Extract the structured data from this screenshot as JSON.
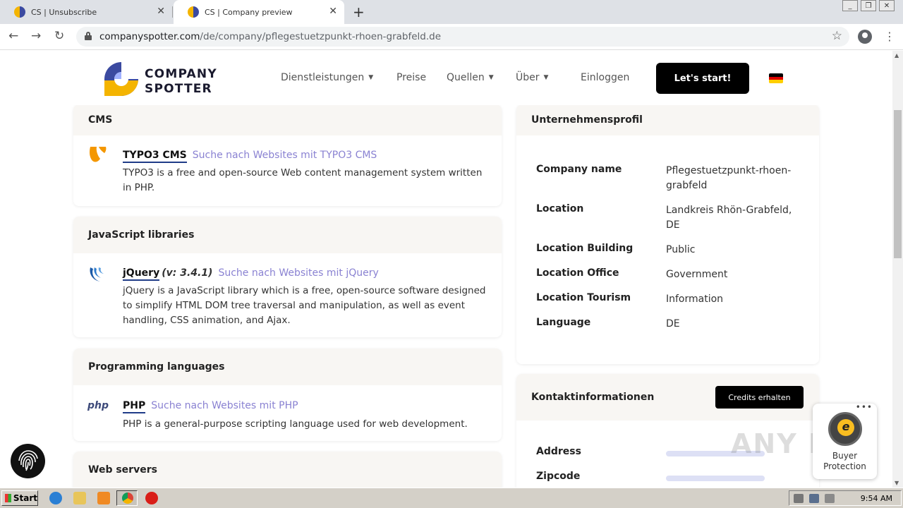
{
  "browser": {
    "tabs": [
      {
        "title": "CS | Unsubscribe",
        "active": false
      },
      {
        "title": "CS | Company preview",
        "active": true
      }
    ],
    "url_host": "companyspotter.com",
    "url_path": "/de/company/pflegestuetzpunkt-rhoen-grabfeld.de"
  },
  "header": {
    "logo_line1": "COMPANY",
    "logo_line2": "SPOTTER",
    "nav": [
      "Dienstleistungen",
      "Preise",
      "Quellen",
      "Über",
      "Einloggen"
    ],
    "cta": "Let's start!"
  },
  "sections": {
    "cms": {
      "title": "CMS",
      "name": "TYPO3 CMS",
      "link": "Suche nach Websites mit TYPO3 CMS",
      "desc": "TYPO3 is a free and open-source Web content management system written in PHP."
    },
    "js": {
      "title": "JavaScript libraries",
      "name": "jQuery",
      "version": "(v: 3.4.1)",
      "link": "Suche nach Websites mit jQuery",
      "desc": "jQuery is a JavaScript library which is a free, open-source software designed to simplify HTML DOM tree traversal and manipulation, as well as event handling, CSS animation, and Ajax."
    },
    "prog": {
      "title": "Programming languages",
      "icon_text": "php",
      "name": "PHP",
      "link": "Suche nach Websites mit PHP",
      "desc": "PHP is a general-purpose scripting language used for web development."
    },
    "web": {
      "title": "Web servers"
    }
  },
  "profile": {
    "title": "Unternehmensprofil",
    "rows": [
      {
        "label": "Company name",
        "value": "Pflegestuetzpunkt-rhoen-grabfeld"
      },
      {
        "label": "Location",
        "value": "Landkreis Rhön-Grabfeld, DE"
      },
      {
        "label": "Location Building",
        "value": "Public"
      },
      {
        "label": "Location Office",
        "value": "Government"
      },
      {
        "label": "Location Tourism",
        "value": "Information"
      },
      {
        "label": "Language",
        "value": "DE"
      }
    ]
  },
  "contact": {
    "title": "Kontaktinformationen",
    "button": "Credits erhalten",
    "rows": [
      {
        "label": "Address"
      },
      {
        "label": "Zipcode"
      }
    ]
  },
  "trusted": {
    "line1": "Buyer",
    "line2": "Protection"
  },
  "watermark": "ANY RUN",
  "taskbar": {
    "start": "Start",
    "clock": "9:54 AM"
  },
  "colors": {
    "link": "#8a82d2",
    "accent_dark": "#1f3c88",
    "section_head_bg": "#f8f6f3",
    "cta_bg": "#000000"
  }
}
